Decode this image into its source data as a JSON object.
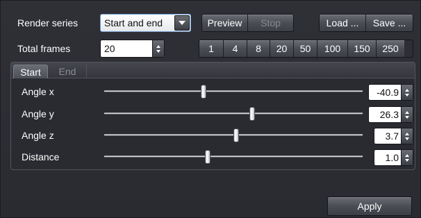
{
  "render_series": {
    "label": "Render series",
    "selected": "Start and end"
  },
  "playback": {
    "preview_label": "Preview",
    "stop_label": "Stop"
  },
  "file": {
    "load_label": "Load ...",
    "save_label": "Save ..."
  },
  "total_frames": {
    "label": "Total frames",
    "value": "20"
  },
  "frame_presets": [
    "1",
    "4",
    "8",
    "20",
    "50",
    "100",
    "150",
    "250"
  ],
  "tabs": {
    "start_label": "Start",
    "end_label": "End",
    "active": "Start"
  },
  "params": [
    {
      "label": "Angle x",
      "value": "-40.9",
      "slider_fraction": 0.385
    },
    {
      "label": "Angle y",
      "value": "26.3",
      "slider_fraction": 0.573
    },
    {
      "label": "Angle z",
      "value": "3.7",
      "slider_fraction": 0.51
    },
    {
      "label": "Distance",
      "value": "1.0",
      "slider_fraction": 0.4
    }
  ],
  "apply_label": "Apply",
  "colors": {
    "background": "#2e2f35",
    "dropdown_focus_border": "#6f9fd6",
    "disabled_text": "#8a8c94"
  }
}
